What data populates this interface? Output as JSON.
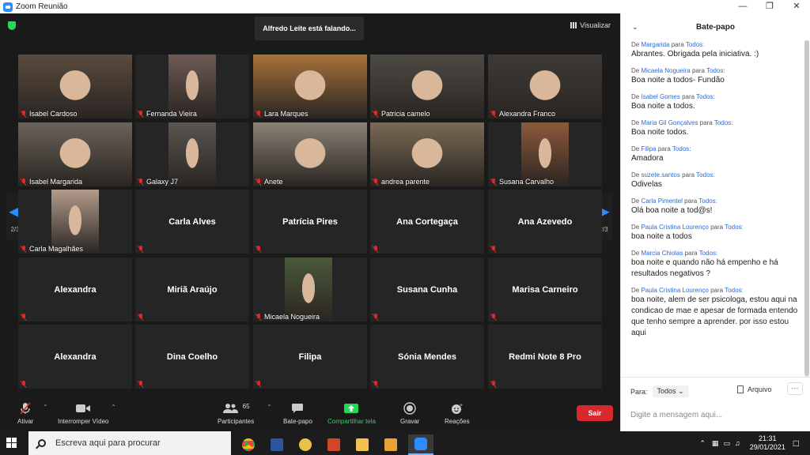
{
  "window": {
    "title": "Zoom Reunião"
  },
  "meeting": {
    "speaking_banner": "Alfredo Leite está falando...",
    "view_label": "Visualizar",
    "page_left": "2/3",
    "page_right": "2/3",
    "tiles": [
      {
        "name": "Isabel Cardoso",
        "video": true,
        "bg": "#5a4a3c"
      },
      {
        "name": "Fernanda Vieira",
        "video": true,
        "bg": "#6e5a55"
      },
      {
        "name": "Lara Marques",
        "video": true,
        "bg": "#a8723a"
      },
      {
        "name": "Patricia camelo",
        "video": true,
        "bg": "#4d4a44"
      },
      {
        "name": "Alexandra Franco",
        "video": true,
        "bg": "#3e3a36"
      },
      {
        "name": "Isabel Margarida",
        "video": true,
        "bg": "#6b6359"
      },
      {
        "name": "Galaxy J7",
        "video": true,
        "bg": "#5a5650"
      },
      {
        "name": "Anete",
        "video": true,
        "bg": "#8a8275"
      },
      {
        "name": "andrea parente",
        "video": true,
        "bg": "#7a6a55"
      },
      {
        "name": "Susana Carvalho",
        "video": true,
        "bg": "#8c5a3a"
      },
      {
        "name": "Carla Magalhães",
        "video": true,
        "bg": "#b39c8c"
      },
      {
        "name": "Carla Alves",
        "video": false
      },
      {
        "name": "Patrícia Pires",
        "video": false
      },
      {
        "name": "Ana Cortegaça",
        "video": false
      },
      {
        "name": "Ana Azevedo",
        "video": false
      },
      {
        "name": "Alexandra",
        "video": false
      },
      {
        "name": "Miriã Araújo",
        "video": false
      },
      {
        "name": "Micaela Nogueira",
        "video": true,
        "bg": "#4a5a3a"
      },
      {
        "name": "Susana Cunha",
        "video": false
      },
      {
        "name": "Marisa Carneiro",
        "video": false
      },
      {
        "name": "Alexandra",
        "video": false
      },
      {
        "name": "Dina Coelho",
        "video": false
      },
      {
        "name": "Filipa",
        "video": false
      },
      {
        "name": "Sónia Mendes",
        "video": false
      },
      {
        "name": "Redmi Note 8 Pro",
        "video": false
      }
    ]
  },
  "toolbar": {
    "unmute": "Ativar",
    "stop_video": "Interromper Vídeo",
    "participants": "Participantes",
    "participants_count": "65",
    "chat": "Bate-papo",
    "share": "Compartilhar tela",
    "record": "Gravar",
    "reactions": "Reações",
    "leave": "Sair",
    "colors": {
      "share": "#23d959",
      "leave": "#d9272e"
    }
  },
  "chat": {
    "title": "Bate-papo",
    "from_word": "De",
    "to_word": "para",
    "messages": [
      {
        "from": "Margarida",
        "to": "Todos:",
        "text": "Abrantes. Obrigada pela iniciativa. :)"
      },
      {
        "from": "Micaela Nogueira",
        "to": "Todos:",
        "text": "Boa noite a todos- Fundão"
      },
      {
        "from": "Isabel Gomes",
        "to": "Todos:",
        "text": "Boa noite a todos."
      },
      {
        "from": "Maria Gil Gonçalves",
        "to": "Todos:",
        "text": "Boa noite  todos."
      },
      {
        "from": "Filipa",
        "to": "Todos:",
        "text": "Amadora"
      },
      {
        "from": "suzete.santos",
        "to": "Todos:",
        "text": "Odivelas"
      },
      {
        "from": "Carla Pimentel",
        "to": "Todos:",
        "text": "Olá  boa noite a tod@s!"
      },
      {
        "from": "Paula Cristina Lourenço",
        "to": "Todos:",
        "text": "boa noite a todos"
      },
      {
        "from": "Marcia Chiolas",
        "to": "Todos:",
        "text": "boa noite e quando não há empenho e há resultados negativos ?"
      },
      {
        "from": "Paula Cristina Lourenço",
        "to": "Todos:",
        "text": "boa noite, alem de ser psicologa, estou aqui na condicao de mae e apesar de formada entendo que tenho sempre a aprender. por isso estou aqui"
      }
    ],
    "to_label": "Para:",
    "to_value": "Todos",
    "file_label": "Arquivo",
    "more_label": "···",
    "input_placeholder": "Digite a mensagem aqui..."
  },
  "taskbar": {
    "search_placeholder": "Escreva aqui para procurar",
    "time": "21:31",
    "date": "29/01/2021"
  }
}
